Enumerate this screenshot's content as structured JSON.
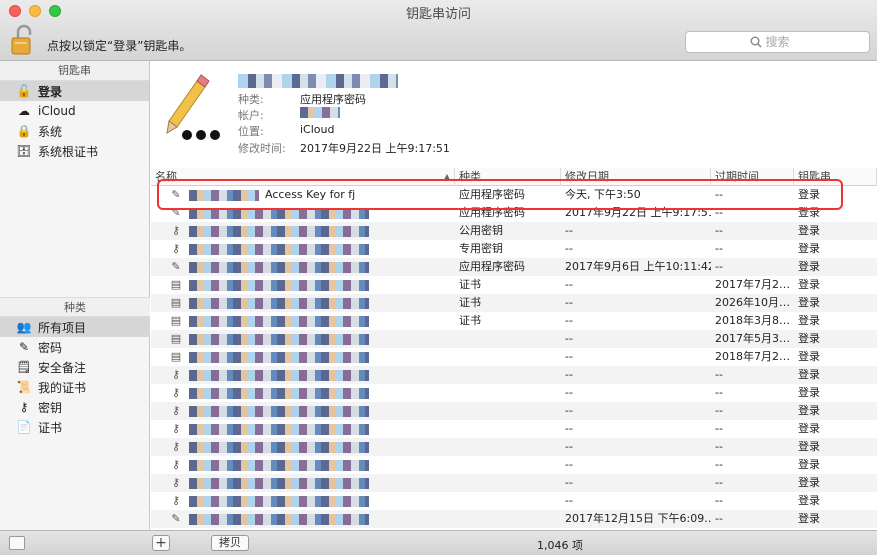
{
  "window": {
    "title": "钥匙串访问"
  },
  "toolbar": {
    "lock_hint": "点按以锁定“登录”钥匙串。",
    "search_placeholder": "搜索"
  },
  "sidebar": {
    "keychains_header": "钥匙串",
    "keychains": [
      {
        "label": "登录",
        "icon": "lock-icon",
        "active": true
      },
      {
        "label": "iCloud",
        "icon": "cloud-icon",
        "active": false
      },
      {
        "label": "系统",
        "icon": "lock-icon",
        "active": false
      },
      {
        "label": "系统根证书",
        "icon": "cabinet-icon",
        "active": false
      }
    ],
    "categories_header": "种类",
    "categories": [
      {
        "label": "所有项目",
        "icon": "people-icon",
        "active": true
      },
      {
        "label": "密码",
        "icon": "pen-icon",
        "active": false
      },
      {
        "label": "安全备注",
        "icon": "note-icon",
        "active": false
      },
      {
        "label": "我的证书",
        "icon": "certificate-icon",
        "active": false
      },
      {
        "label": "密钥",
        "icon": "key-icon",
        "active": false
      },
      {
        "label": "证书",
        "icon": "certificate-icon",
        "active": false
      }
    ]
  },
  "detail": {
    "kind_label": "种类:",
    "kind_value": "应用程序密码",
    "account_label": "帐户:",
    "location_label": "位置:",
    "location_value": "iCloud",
    "modified_label": "修改时间:",
    "modified_value": "2017年9月22日 上午9:17:51"
  },
  "table": {
    "columns": [
      "名称",
      "种类",
      "修改日期",
      "过期时间",
      "钥匙串"
    ],
    "rows": [
      {
        "name": "Access Key for fj",
        "kind": "应用程序密码",
        "modified": "今天, 下午3:50",
        "expires": "--",
        "keychain": "登录",
        "icon": "pen-icon",
        "highlighted": true
      },
      {
        "name": "",
        "kind": "应用程序密码",
        "modified": "2017年9月22日 上午9:17:51",
        "expires": "--",
        "keychain": "登录",
        "icon": "pen-icon",
        "highlighted": false
      },
      {
        "name": "",
        "kind": "公用密钥",
        "modified": "--",
        "expires": "--",
        "keychain": "登录",
        "icon": "key-icon",
        "highlighted": false
      },
      {
        "name": "",
        "kind": "专用密钥",
        "modified": "--",
        "expires": "--",
        "keychain": "登录",
        "icon": "key-icon",
        "highlighted": false
      },
      {
        "name": "",
        "kind": "应用程序密码",
        "modified": "2017年9月6日 上午10:11:42",
        "expires": "--",
        "keychain": "登录",
        "icon": "pen-icon",
        "highlighted": false
      },
      {
        "name": "",
        "kind": "证书",
        "modified": "--",
        "expires": "2017年7月2…",
        "keychain": "登录",
        "icon": "certificate-icon",
        "highlighted": false
      },
      {
        "name": "",
        "kind": "证书",
        "modified": "--",
        "expires": "2026年10月…",
        "keychain": "登录",
        "icon": "certificate-icon",
        "highlighted": false
      },
      {
        "name": "",
        "kind": "证书",
        "modified": "--",
        "expires": "2018年3月8…",
        "keychain": "登录",
        "icon": "certificate-icon",
        "highlighted": false
      },
      {
        "name": "",
        "kind": "",
        "modified": "--",
        "expires": "2017年5月3…",
        "keychain": "登录",
        "icon": "certificate-icon",
        "highlighted": false
      },
      {
        "name": "",
        "kind": "",
        "modified": "--",
        "expires": "2018年7月2…",
        "keychain": "登录",
        "icon": "certificate-icon",
        "highlighted": false
      },
      {
        "name": "",
        "kind": "",
        "modified": "--",
        "expires": "--",
        "keychain": "登录",
        "icon": "key-icon",
        "highlighted": false
      },
      {
        "name": "",
        "kind": "",
        "modified": "--",
        "expires": "--",
        "keychain": "登录",
        "icon": "key-icon",
        "highlighted": false
      },
      {
        "name": "",
        "kind": "",
        "modified": "--",
        "expires": "--",
        "keychain": "登录",
        "icon": "key-icon",
        "highlighted": false
      },
      {
        "name": "",
        "kind": "",
        "modified": "--",
        "expires": "--",
        "keychain": "登录",
        "icon": "key-icon",
        "highlighted": false
      },
      {
        "name": "",
        "kind": "",
        "modified": "--",
        "expires": "--",
        "keychain": "登录",
        "icon": "key-icon",
        "highlighted": false
      },
      {
        "name": "",
        "kind": "",
        "modified": "--",
        "expires": "--",
        "keychain": "登录",
        "icon": "key-icon",
        "highlighted": false
      },
      {
        "name": "",
        "kind": "",
        "modified": "--",
        "expires": "--",
        "keychain": "登录",
        "icon": "key-icon",
        "highlighted": false
      },
      {
        "name": "",
        "kind": "",
        "modified": "--",
        "expires": "--",
        "keychain": "登录",
        "icon": "key-icon",
        "highlighted": false
      },
      {
        "name": "",
        "kind": "",
        "modified": "2017年12月15日 下午6:09…",
        "expires": "--",
        "keychain": "登录",
        "icon": "pen-icon",
        "highlighted": false
      }
    ]
  },
  "bottombar": {
    "add_label": "+",
    "copy_label": "拷贝",
    "count_label": "1,046 项"
  }
}
